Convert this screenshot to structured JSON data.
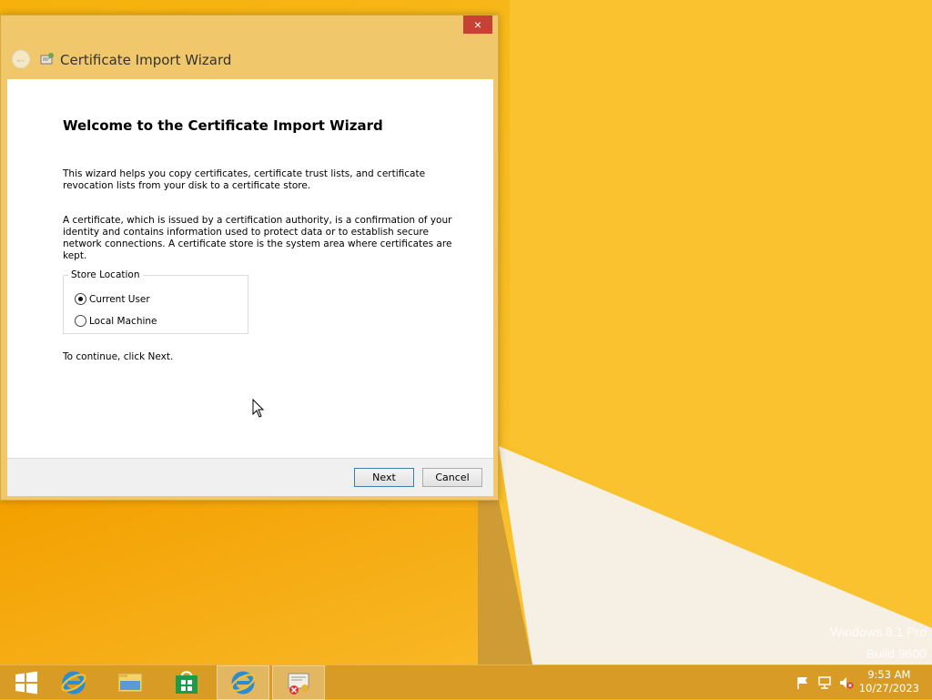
{
  "desktop": {
    "watermark": {
      "line1": "Windows 8.1 Pro",
      "line2": "Build 9600"
    }
  },
  "window": {
    "close_label": "×",
    "title": "Certificate Import Wizard",
    "heading": "Welcome to the Certificate Import Wizard",
    "paragraph1": "This wizard helps you copy certificates, certificate trust lists, and certificate revocation lists from your disk to a certificate store.",
    "paragraph2": "A certificate, which is issued by a certification authority, is a confirmation of your identity and contains information used to protect data or to establish secure network connections. A certificate store is the system area where certificates are kept.",
    "store_location": {
      "legend": "Store Location",
      "options": [
        {
          "label": "Current User",
          "selected": true
        },
        {
          "label": "Local Machine",
          "selected": false
        }
      ]
    },
    "continue_text": "To continue, click Next.",
    "buttons": {
      "next": "Next",
      "cancel": "Cancel"
    }
  },
  "taskbar": {
    "items": [
      {
        "icon": "windows-start-icon"
      },
      {
        "icon": "internet-explorer-icon"
      },
      {
        "icon": "file-explorer-icon"
      },
      {
        "icon": "store-icon"
      },
      {
        "icon": "internet-explorer-icon",
        "active": true
      },
      {
        "icon": "certificate-icon",
        "active": true
      }
    ],
    "tray": {
      "icons": [
        "flag-icon",
        "network-icon",
        "speaker-muted-icon"
      ],
      "time": "9:53 AM",
      "date": "10/27/2023"
    }
  },
  "colors": {
    "wallpaper": "#f8b40e",
    "window_frame": "#f0c76a",
    "close_button": "#c74135",
    "taskbar": "#d89c26"
  }
}
